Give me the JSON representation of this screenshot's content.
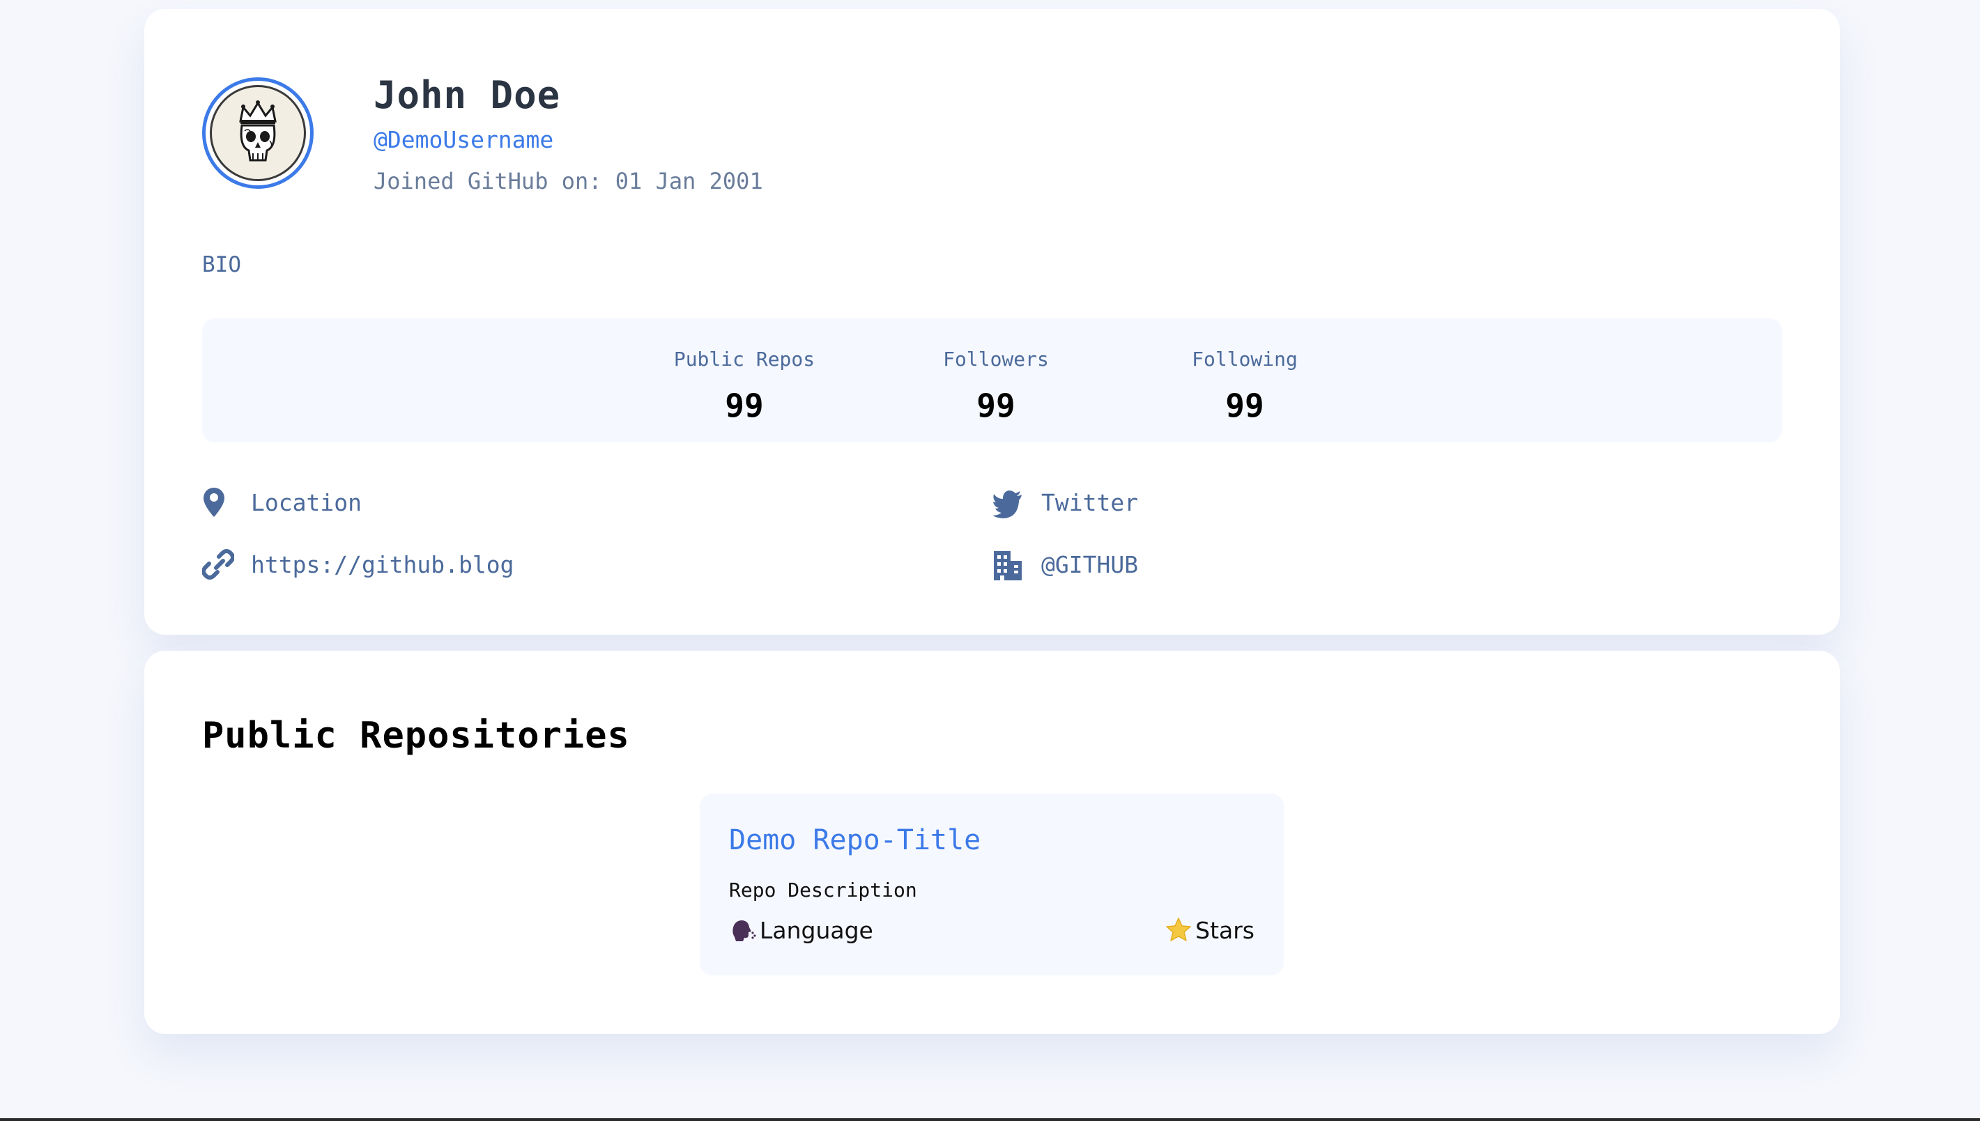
{
  "profile": {
    "name": "John Doe",
    "username": "@DemoUsername",
    "joined": "Joined GitHub on: 01 Jan 2001",
    "bio": "BIO",
    "avatar_icon": "skull-crown-avatar"
  },
  "stats": {
    "repos_label": "Public Repos",
    "repos_value": "99",
    "followers_label": "Followers",
    "followers_value": "99",
    "following_label": "Following",
    "following_value": "99"
  },
  "links": {
    "location": "Location",
    "blog": "https://github.blog",
    "twitter": "Twitter",
    "company": "@GITHUB"
  },
  "repositories": {
    "title": "Public Repositories",
    "items": [
      {
        "title": "Demo Repo-Title",
        "description": "Repo Description",
        "language": "Language",
        "stars": "Stars",
        "language_icon": "speaking-head-icon",
        "stars_icon": "star-icon"
      }
    ]
  },
  "colors": {
    "accent": "#3b7ae8",
    "muted": "#4b6a9b",
    "background": "#f5f7fc",
    "card": "#ffffff",
    "stats_bg": "#f6f8ff"
  }
}
